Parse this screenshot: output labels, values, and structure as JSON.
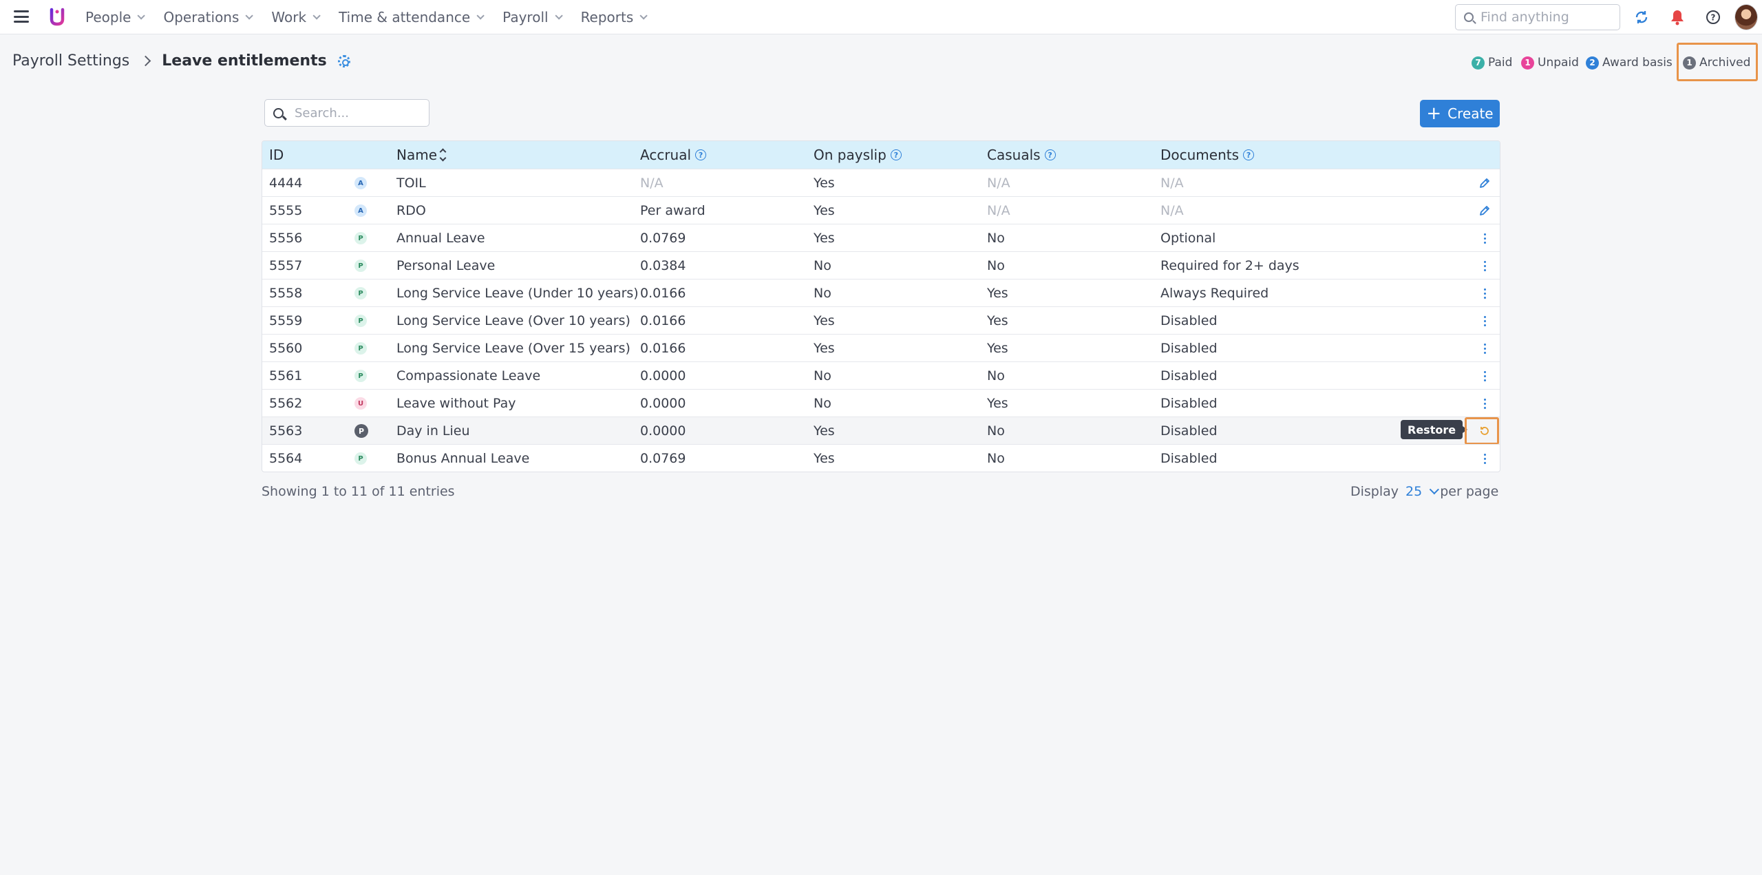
{
  "nav": {
    "items": [
      "People",
      "Operations",
      "Work",
      "Time & attendance",
      "Payroll",
      "Reports"
    ],
    "search_placeholder": "Find anything"
  },
  "header": {
    "breadcrumb_root": "Payroll Settings",
    "breadcrumb_current": "Leave entitlements"
  },
  "legend": [
    {
      "count": "7",
      "label": "Paid",
      "color": "#3bb0a8"
    },
    {
      "count": "1",
      "label": "Unpaid",
      "color": "#e8449a"
    },
    {
      "count": "2",
      "label": "Award basis",
      "color": "#2f80d8"
    },
    {
      "count": "1",
      "label": "Archived",
      "color": "#6b707c"
    }
  ],
  "toolbar": {
    "search_placeholder": "Search...",
    "create_label": "Create"
  },
  "table": {
    "columns": [
      "ID",
      "Name",
      "Accrual",
      "On payslip",
      "Casuals",
      "Documents"
    ],
    "rows": [
      {
        "id": "4444",
        "type": "A",
        "name": "TOIL",
        "accrual": "N/A",
        "on_payslip": "Yes",
        "casuals": "N/A",
        "documents": "N/A",
        "action": "edit"
      },
      {
        "id": "5555",
        "type": "A",
        "name": "RDO",
        "accrual": "Per award",
        "on_payslip": "Yes",
        "casuals": "N/A",
        "documents": "N/A",
        "action": "edit"
      },
      {
        "id": "5556",
        "type": "P",
        "name": "Annual Leave",
        "accrual": "0.0769",
        "on_payslip": "Yes",
        "casuals": "No",
        "documents": "Optional",
        "action": "menu"
      },
      {
        "id": "5557",
        "type": "P",
        "name": "Personal Leave",
        "accrual": "0.0384",
        "on_payslip": "No",
        "casuals": "No",
        "documents": "Required for 2+ days",
        "action": "menu"
      },
      {
        "id": "5558",
        "type": "P",
        "name": "Long Service Leave (Under 10 years)",
        "accrual": "0.0166",
        "on_payslip": "No",
        "casuals": "Yes",
        "documents": "Always Required",
        "action": "menu"
      },
      {
        "id": "5559",
        "type": "P",
        "name": "Long Service Leave (Over 10 years)",
        "accrual": "0.0166",
        "on_payslip": "Yes",
        "casuals": "Yes",
        "documents": "Disabled",
        "action": "menu"
      },
      {
        "id": "5560",
        "type": "P",
        "name": "Long Service Leave (Over 15 years)",
        "accrual": "0.0166",
        "on_payslip": "Yes",
        "casuals": "Yes",
        "documents": "Disabled",
        "action": "menu"
      },
      {
        "id": "5561",
        "type": "P",
        "name": "Compassionate Leave",
        "accrual": "0.0000",
        "on_payslip": "No",
        "casuals": "No",
        "documents": "Disabled",
        "action": "menu"
      },
      {
        "id": "5562",
        "type": "U",
        "name": "Leave without Pay",
        "accrual": "0.0000",
        "on_payslip": "No",
        "casuals": "Yes",
        "documents": "Disabled",
        "action": "menu"
      },
      {
        "id": "5563",
        "type": "P",
        "name": "Day in Lieu",
        "accrual": "0.0000",
        "on_payslip": "Yes",
        "casuals": "No",
        "documents": "Disabled",
        "action": "restore",
        "archived": true
      },
      {
        "id": "5564",
        "type": "P",
        "name": "Bonus Annual Leave",
        "accrual": "0.0769",
        "on_payslip": "Yes",
        "casuals": "No",
        "documents": "Disabled",
        "action": "menu"
      }
    ],
    "tooltip": "Restore"
  },
  "footer": {
    "showing": "Showing 1 to 11 of 11 entries",
    "display_label": "Display",
    "per_page_value": "25",
    "per_page_suffix": "per page"
  },
  "colors": {
    "accent": "#2f80d8",
    "header_bg": "#d8f0fb",
    "highlight": "#e8944a",
    "notification": "#e64545"
  }
}
